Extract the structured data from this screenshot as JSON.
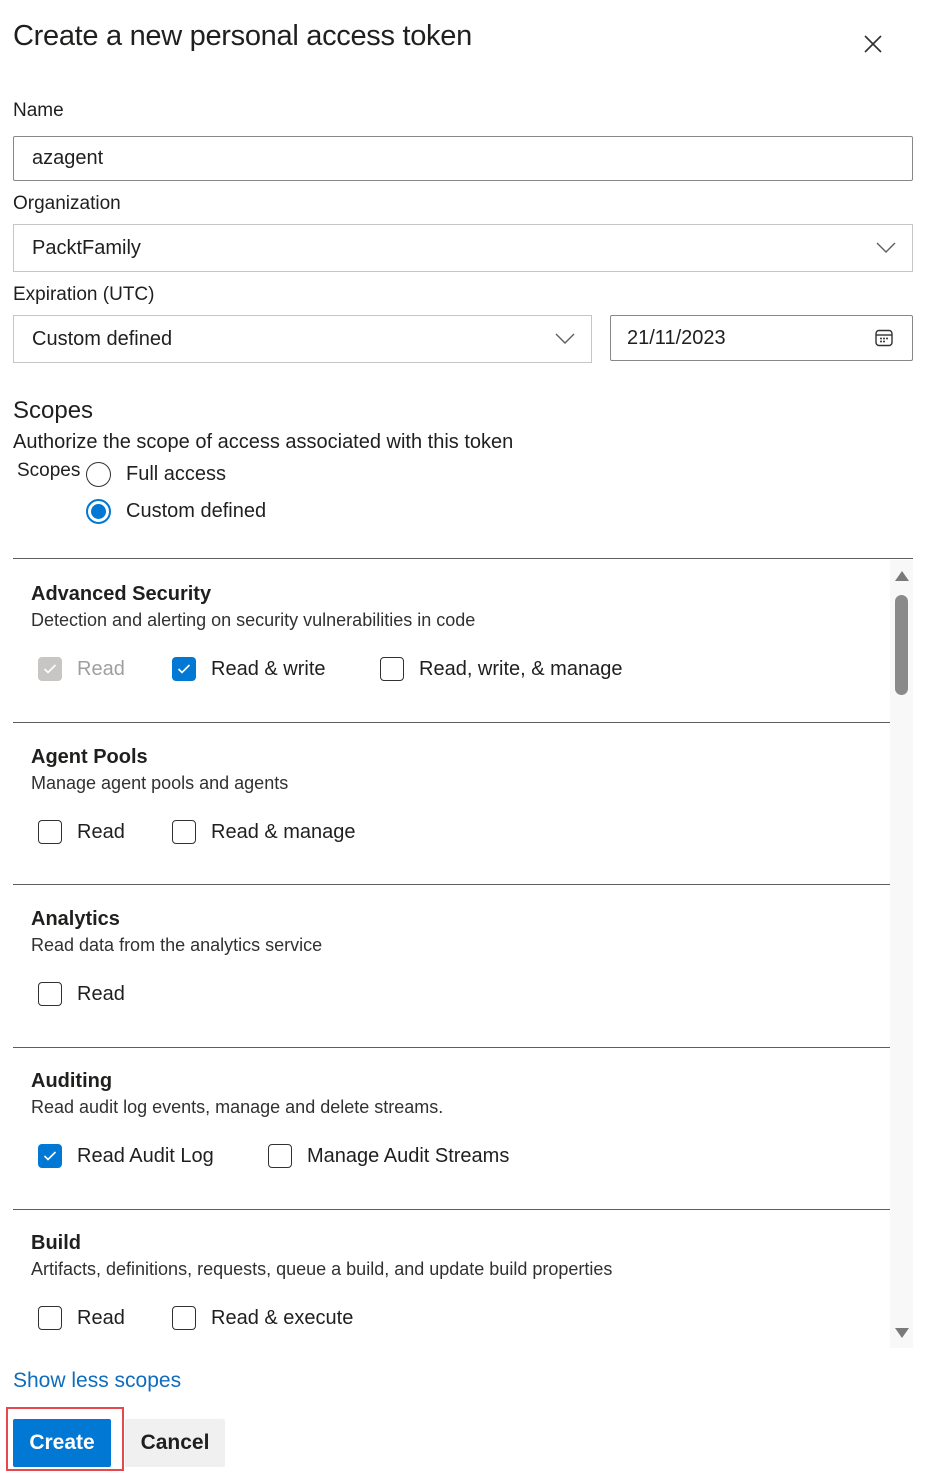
{
  "dialog": {
    "title": "Create a new personal access token",
    "close_icon": "close-icon"
  },
  "form": {
    "name": {
      "label": "Name",
      "value": "azagent"
    },
    "organization": {
      "label": "Organization",
      "selected": "PacktFamily"
    },
    "expiration": {
      "label": "Expiration (UTC)",
      "selected": "Custom defined",
      "date": "21/11/2023",
      "calendar_icon": "calendar-icon"
    }
  },
  "scopes": {
    "heading": "Scopes",
    "description": "Authorize the scope of access associated with this token",
    "inline_label": "Scopes",
    "options": [
      {
        "label": "Full access",
        "checked": false
      },
      {
        "label": "Custom defined",
        "checked": true
      }
    ],
    "sections": [
      {
        "title": "Advanced Security",
        "description": "Detection and alerting on security vulnerabilities in code",
        "checkboxes": [
          {
            "label": "Read",
            "checked": true,
            "disabled": true
          },
          {
            "label": "Read & write",
            "checked": true,
            "disabled": false
          },
          {
            "label": "Read, write, & manage",
            "checked": false,
            "disabled": false
          }
        ]
      },
      {
        "title": "Agent Pools",
        "description": "Manage agent pools and agents",
        "checkboxes": [
          {
            "label": "Read",
            "checked": false,
            "disabled": false
          },
          {
            "label": "Read & manage",
            "checked": false,
            "disabled": false
          }
        ]
      },
      {
        "title": "Analytics",
        "description": "Read data from the analytics service",
        "checkboxes": [
          {
            "label": "Read",
            "checked": false,
            "disabled": false
          }
        ]
      },
      {
        "title": "Auditing",
        "description": "Read audit log events, manage and delete streams.",
        "checkboxes": [
          {
            "label": "Read Audit Log",
            "checked": true,
            "disabled": false
          },
          {
            "label": "Manage Audit Streams",
            "checked": false,
            "disabled": false
          }
        ]
      },
      {
        "title": "Build",
        "description": "Artifacts, definitions, requests, queue a build, and update build properties",
        "checkboxes": [
          {
            "label": "Read",
            "checked": false,
            "disabled": false
          },
          {
            "label": "Read & execute",
            "checked": false,
            "disabled": false
          }
        ]
      }
    ],
    "show_less_link": "Show less scopes"
  },
  "footer": {
    "create_label": "Create",
    "cancel_label": "Cancel"
  },
  "colors": {
    "accent": "#0078d4",
    "link": "#0f6cbd",
    "highlight": "#e5484d"
  }
}
